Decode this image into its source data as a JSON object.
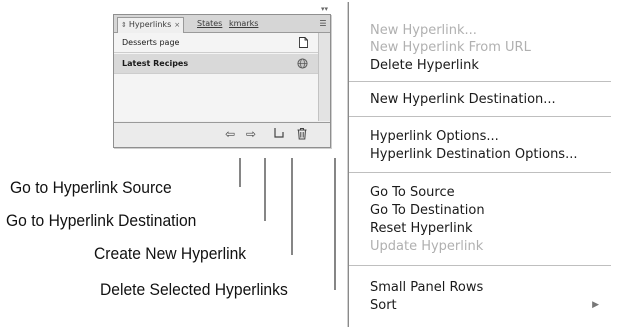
{
  "panel": {
    "tabs": [
      {
        "label": "Hyperlinks",
        "close": "×"
      },
      {
        "label": "States"
      },
      {
        "label": "kmarks"
      }
    ],
    "rows": [
      {
        "label": "Desserts page",
        "icon": "page-icon"
      },
      {
        "label": "Latest Recipes",
        "icon": "url-globe-icon",
        "selected": true
      }
    ],
    "bottom_icons": [
      "go-to-source-icon",
      "go-to-destination-icon",
      "new-hyperlink-icon",
      "delete-icon"
    ]
  },
  "callouts": [
    {
      "label": "Go to Hyperlink Source"
    },
    {
      "label": "Go to Hyperlink Destination"
    },
    {
      "label": "Create New Hyperlink"
    },
    {
      "label": "Delete Selected Hyperlinks"
    }
  ],
  "menu": {
    "items": [
      {
        "label": "New Hyperlink...",
        "disabled": true
      },
      {
        "label": "New Hyperlink From URL",
        "disabled": true
      },
      {
        "label": "Delete Hyperlink",
        "disabled": false
      },
      {
        "label": "New Hyperlink Destination...",
        "disabled": false
      },
      {
        "label": "Hyperlink Options...",
        "disabled": false
      },
      {
        "label": "Hyperlink Destination Options...",
        "disabled": false
      },
      {
        "label": "Go To Source",
        "disabled": false
      },
      {
        "label": "Go To Destination",
        "disabled": false
      },
      {
        "label": "Reset Hyperlink",
        "disabled": false
      },
      {
        "label": "Update Hyperlink",
        "disabled": true
      },
      {
        "label": "Small Panel Rows",
        "disabled": false
      },
      {
        "label": "Sort",
        "disabled": false,
        "submenu": true
      }
    ]
  }
}
